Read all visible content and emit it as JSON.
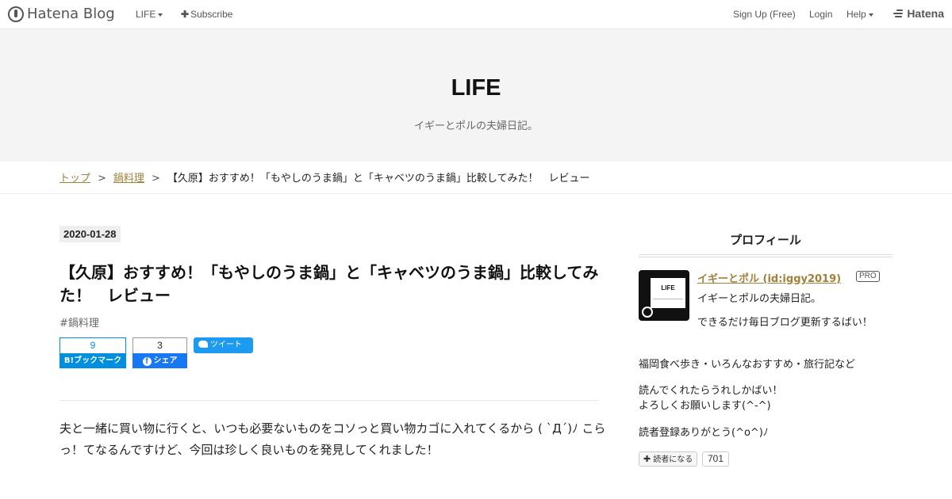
{
  "topbar": {
    "brand": "Hatena Blog",
    "life_menu": "LIFE",
    "subscribe": "Subscribe",
    "signup": "Sign Up (Free)",
    "login": "Login",
    "help": "Help",
    "hatena": "Hatena"
  },
  "header": {
    "title": "LIFE",
    "description": "イギーとポルの夫婦日記。"
  },
  "breadcrumb": {
    "top": "トップ",
    "category": "鍋料理",
    "current": "【久原】おすすめ！「もやしのうま鍋」と「キャベツのうま鍋」比較してみた！　レビュー",
    "separator": ">"
  },
  "article": {
    "date": "2020-01-28",
    "title": "【久原】おすすめ！「もやしのうま鍋」と「キャベツのうま鍋」比較してみた！　レビュー",
    "category": "#鍋料理",
    "bookmark_count": "9",
    "bookmark_label": "B!ブックマーク",
    "share_count": "3",
    "share_label": "シェア",
    "tweet_label": "ツイート",
    "body": "夫と一緒に買い物に行くと、いつも必要ないものをコソっと買い物カゴに入れてくるから ( `Д´)ﾉ こらっ！てなるんですけど、今回は珍しく良いものを発見してくれました！"
  },
  "sidebar": {
    "title": "プロフィール",
    "avatar_text": "LIFE",
    "name": "イギーとポル (id:iggy2019)",
    "badge": "PRO",
    "desc": "イギーとポルの夫婦日記。",
    "p1": "できるだけ毎日ブログ更新するばい！",
    "p2": "福岡食べ歩き・いろんなおすすめ・旅行記など",
    "p3a": "読んでくれたらうれしかばい！",
    "p3b": "よろしくお願いします(^-^)",
    "p4": "読者登録ありがとう(^o^)ﾉ",
    "subscribe_label": "読者になる",
    "subscriber_count": "701"
  },
  "colors": {
    "link": "#a0803a",
    "hatebu": "#008fde",
    "facebook": "#1877f2",
    "twitter": "#1d9bf0"
  }
}
